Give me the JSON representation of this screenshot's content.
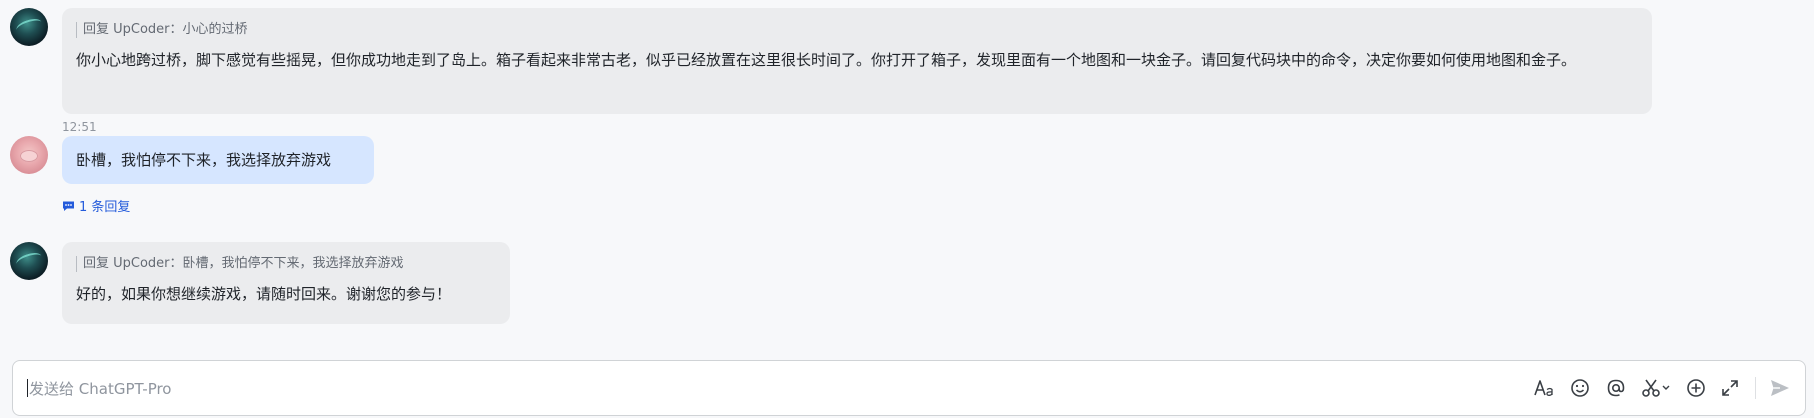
{
  "messages": [
    {
      "sender": "bot",
      "avatar_icon": "bot-avatar",
      "quote": "回复 UpCoder：小心的过桥",
      "text": "你小心地跨过桥，脚下感觉有些摇晃，但你成功地走到了岛上。箱子看起来非常古老，似乎已经放置在这里很长时间了。你打开了箱子，发现里面有一个地图和一块金子。请回复代码块中的命令，决定你要如何使用地图和金子。"
    },
    {
      "sender": "user",
      "avatar_icon": "user-avatar",
      "time": "12:51",
      "text": "卧槽，我怕停不下来，我选择放弃游戏",
      "reply_count_label": "1 条回复"
    },
    {
      "sender": "bot",
      "avatar_icon": "bot-avatar",
      "quote": "回复 UpCoder：卧槽，我怕停不下来，我选择放弃游戏",
      "text": "好的，如果你想继续游戏，请随时回来。谢谢您的参与！"
    }
  ],
  "composer": {
    "placeholder": "发送给 ChatGPT-Pro",
    "value": "",
    "tools": [
      "text-format-icon",
      "emoji-icon",
      "mention-icon",
      "scissors-icon",
      "add-icon",
      "expand-icon",
      "send-icon"
    ]
  },
  "colors": {
    "bot_bubble": "#ebecee",
    "user_bubble": "#d6e6ff",
    "link": "#245bdb",
    "background": "#f7f8fa"
  }
}
